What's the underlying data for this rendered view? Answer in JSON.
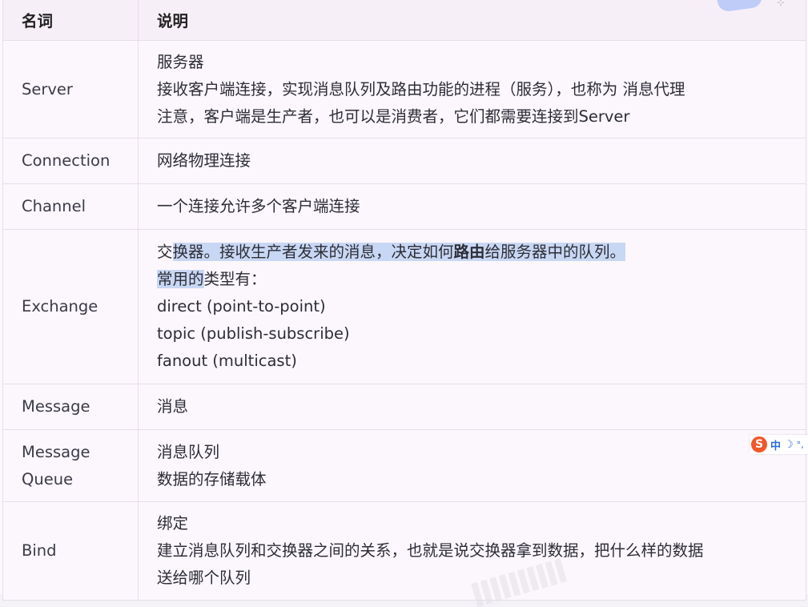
{
  "table": {
    "headers": [
      "名词",
      "说明"
    ],
    "rows": [
      {
        "term": "Server",
        "lines": [
          "服务器",
          "接收客户端连接，实现消息队列及路由功能的进程（服务），也称为 消息代理",
          "注意，客户端是生产者，也可以是消费者，它们都需要连接到Server"
        ]
      },
      {
        "term": "Connection",
        "lines": [
          "网络物理连接"
        ]
      },
      {
        "term": "Channel",
        "lines": [
          "一个连接允许多个客户端连接"
        ]
      },
      {
        "term": "Exchange",
        "line1": {
          "a": "交",
          "b": "换器。接收生产者发来的消息，决定如何",
          "c": "路由",
          "d": "给服务器中的队列。"
        },
        "line2": {
          "a": "常用的",
          "b": "类型有："
        },
        "lines_rest": [
          "direct (point-to-point)",
          "topic (publish-subscribe)",
          "fanout (multicast)"
        ]
      },
      {
        "term": "Message",
        "lines": [
          "消息"
        ]
      },
      {
        "term_lines": [
          "Message",
          "Queue"
        ],
        "lines": [
          "消息队列",
          "数据的存储载体"
        ]
      },
      {
        "term": "Bind",
        "lines": [
          "绑定",
          "建立消息队列和交换器之间的关系，也就是说交换器拿到数据，把什么样的数据",
          "送给哪个队列"
        ]
      }
    ]
  },
  "ime": {
    "logo": "S",
    "mode": "中",
    "moon_icon": "crescent-moon-icon",
    "dot": "°,"
  },
  "colors": {
    "highlight": "#c8d7f3",
    "border": "#e6dde9",
    "ime_logo": "#f0572a",
    "ime_text": "#2a6ed8"
  }
}
